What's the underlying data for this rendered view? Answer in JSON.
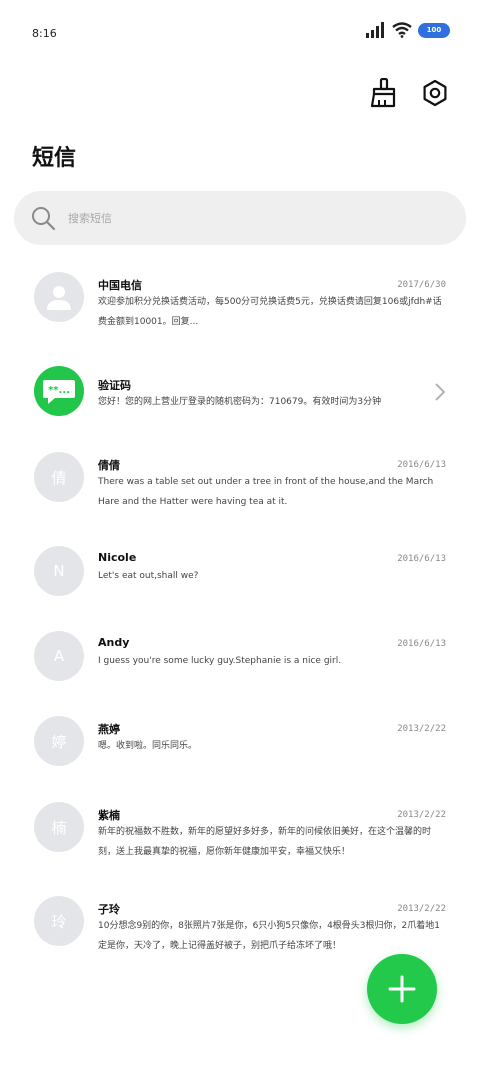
{
  "status": {
    "time": "8:16",
    "battery": "100"
  },
  "title": "短信",
  "search": {
    "placeholder": "搜索短信"
  },
  "messages": [
    {
      "name": "中国电信",
      "date": "2017/6/30",
      "text": "欢迎参加积分兑换话费活动，每500分可兑换话费5元，兑换话费请回复106或jfdh#话费金额到10001。回复...",
      "avatar": "person",
      "avatar_char": ""
    },
    {
      "name": "验证码",
      "date": "",
      "text": "您好！您的网上营业厅登录的随机密码为：710679。有效时间为3分钟",
      "avatar": "chat",
      "avatar_char": ""
    },
    {
      "name": "倩倩",
      "date": "2016/6/13",
      "text": "There was a table set out under a tree in front of the house,and the March Hare and the Hatter were having tea at it.",
      "avatar": "char",
      "avatar_char": "倩"
    },
    {
      "name": "Nicole",
      "date": "2016/6/13",
      "text": "Let's eat out,shall we?",
      "avatar": "char",
      "avatar_char": "N"
    },
    {
      "name": "Andy",
      "date": "2016/6/13",
      "text": "I guess you're some lucky guy.Stephanie is a nice girl.",
      "avatar": "char",
      "avatar_char": "A"
    },
    {
      "name": "燕婷",
      "date": "2013/2/22",
      "text": "嗯。收到啦。同乐同乐。",
      "avatar": "char",
      "avatar_char": "婷"
    },
    {
      "name": "紫楠",
      "date": "2013/2/22",
      "text": "新年的祝福数不胜数，新年的愿望好多好多，新年的问候依旧美好，在这个温馨的时刻，送上我最真挚的祝福，愿你新年健康加平安，幸福又快乐！",
      "avatar": "char",
      "avatar_char": "楠"
    },
    {
      "name": "子玲",
      "date": "2013/2/22",
      "text": "10分想念9别的你，8张照片7张是你，6只小狗5只像你，4根骨头3根归你，2爪着地1定是你，天冷了，晚上记得盖好被子，别把爪子给冻坏了哦！",
      "avatar": "char",
      "avatar_char": "玲"
    }
  ],
  "colors": {
    "accent": "#22c94b",
    "avatar_bg": "#e4e5e9",
    "search_bg": "#efefef"
  }
}
